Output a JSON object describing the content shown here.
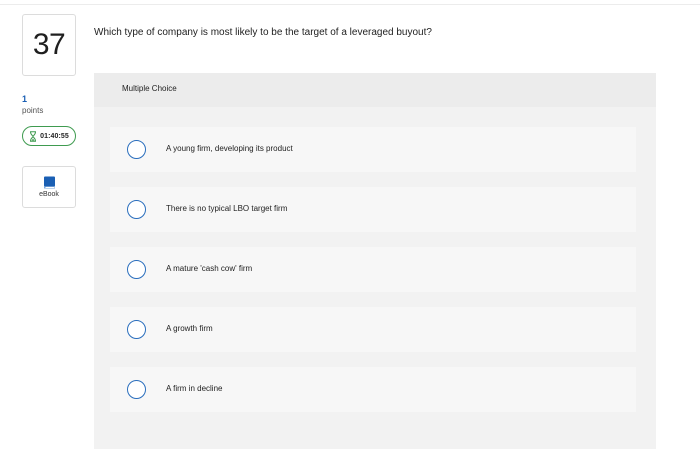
{
  "question_number": "37",
  "points": {
    "value": "1",
    "label": "points"
  },
  "timer": {
    "value": "01:40:55",
    "icon": "hourglass-icon",
    "color": "#3f9b50"
  },
  "ebook": {
    "label": "eBook",
    "icon": "book-icon",
    "color": "#1a5fb4"
  },
  "question_text": "Which type of company is most likely to be the target of a leveraged buyout?",
  "answer_format": "Multiple Choice",
  "choices": [
    {
      "label": "A young firm, developing its product",
      "selected": false
    },
    {
      "label": "There is no typical LBO target firm",
      "selected": false
    },
    {
      "label": "A mature 'cash cow' firm",
      "selected": false
    },
    {
      "label": "A growth firm",
      "selected": false
    },
    {
      "label": "A firm in decline",
      "selected": false
    }
  ],
  "colors": {
    "radio_border": "#2a6ebd",
    "panel_bg": "#f2f2f2",
    "choice_bg": "#f7f7f7"
  }
}
